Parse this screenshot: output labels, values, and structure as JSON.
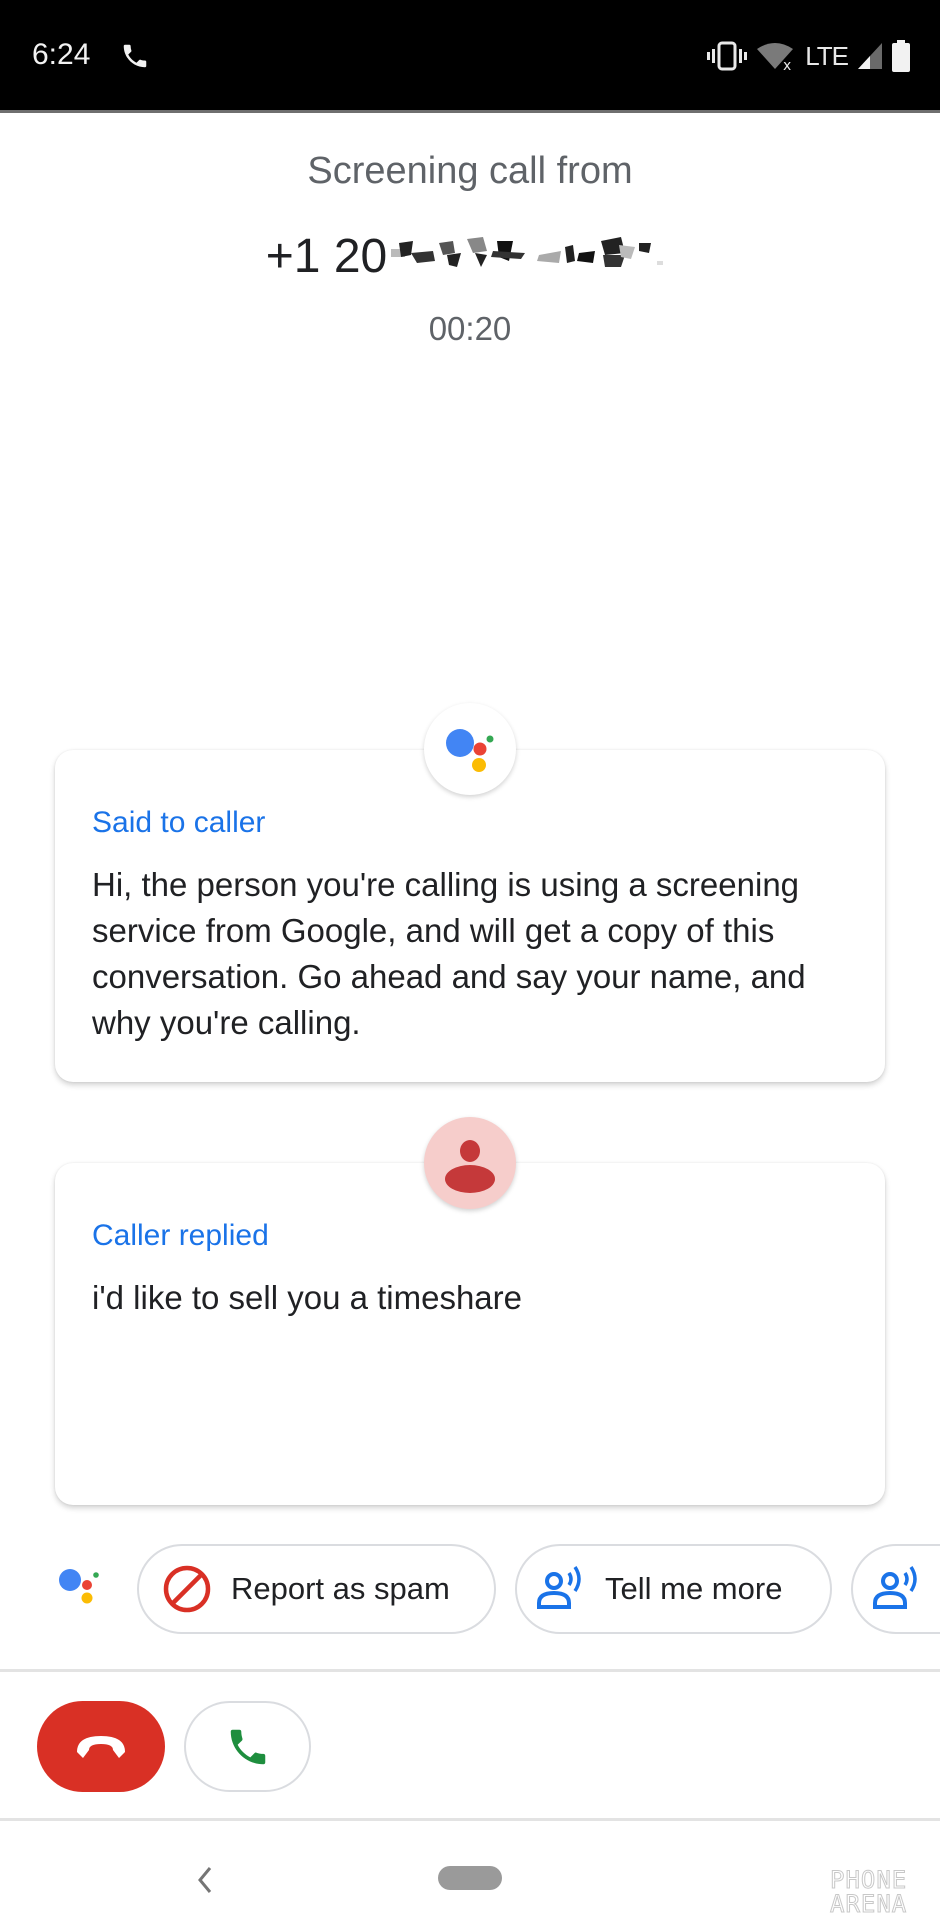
{
  "status_bar": {
    "time": "6:24",
    "icons": [
      "phone-call-icon",
      "vibrate-icon",
      "wifi-off-icon",
      "signal-icon",
      "battery-icon"
    ],
    "network": "LTE"
  },
  "header": {
    "title": "Screening call from",
    "phone_prefix": "+1 20",
    "phone_redacted": true,
    "timer": "00:20"
  },
  "transcript": [
    {
      "speaker_icon": "google-assistant-icon",
      "label": "Said to caller",
      "text": "Hi, the person you're calling is using a screening service from Google, and will get a copy of this conversation. Go ahead and say your name, and why you're calling."
    },
    {
      "speaker_icon": "caller-avatar-icon",
      "label": "Caller replied",
      "text": "i'd like to sell you a timeshare"
    }
  ],
  "suggestions": {
    "leading_icon": "google-assistant-icon",
    "chips": [
      {
        "label": "Report as spam",
        "icon": "block-icon"
      },
      {
        "label": "Tell me more",
        "icon": "speak-person-icon"
      },
      {
        "label": "",
        "icon": "speak-person-icon"
      }
    ]
  },
  "call_controls": {
    "decline_icon": "hang-up-icon",
    "accept_icon": "phone-icon"
  },
  "nav": {
    "back_icon": "back-chevron-icon",
    "home_icon": "home-pill-icon"
  },
  "watermark": {
    "line1": "PHONE",
    "line2": "ARENA"
  },
  "colors": {
    "accent_blue": "#1a73e8",
    "decline_red": "#d93025",
    "accept_green": "#1e8e3e",
    "caller_avatar_bg": "#f6cdcb",
    "caller_avatar_fg": "#c5393a",
    "assistant_blue": "#4285f4",
    "assistant_red": "#ea4335",
    "assistant_yellow": "#fbbc04",
    "assistant_green": "#34a853"
  }
}
